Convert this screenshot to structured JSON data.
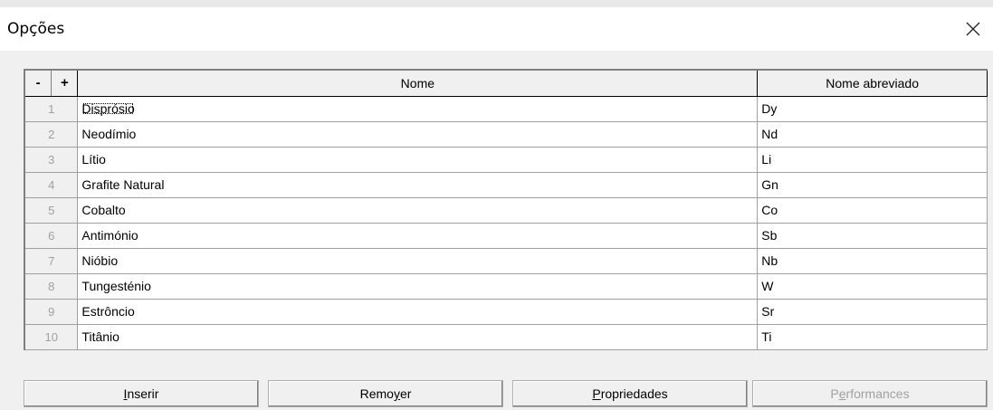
{
  "dialog": {
    "title": "Opções",
    "close_label": "✕"
  },
  "grid": {
    "ctrl_minus": "-",
    "ctrl_plus": "+",
    "columns": [
      "Nome",
      "Nome abreviado"
    ],
    "rows": [
      {
        "num": "1",
        "name": "Disprósio",
        "abbr": "Dy"
      },
      {
        "num": "2",
        "name": "Neodímio",
        "abbr": "Nd"
      },
      {
        "num": "3",
        "name": "Lítio",
        "abbr": "Li"
      },
      {
        "num": "4",
        "name": "Grafite Natural",
        "abbr": "Gn"
      },
      {
        "num": "5",
        "name": "Cobalto",
        "abbr": "Co"
      },
      {
        "num": "6",
        "name": "Antimónio",
        "abbr": "Sb"
      },
      {
        "num": "7",
        "name": "Nióbio",
        "abbr": "Nb"
      },
      {
        "num": "8",
        "name": "Tungesténio",
        "abbr": "W"
      },
      {
        "num": "9",
        "name": "Estrôncio",
        "abbr": "Sr"
      },
      {
        "num": "10",
        "name": "Titânio",
        "abbr": "Ti"
      }
    ]
  },
  "buttons": {
    "insert": {
      "pre": "",
      "key": "I",
      "post": "nserir"
    },
    "remove": {
      "pre": "Remo",
      "key": "y",
      "post": "er"
    },
    "properties": {
      "pre": "",
      "key": "P",
      "post": "ropriedades"
    },
    "performances": {
      "pre": "P",
      "key": "e",
      "post": "rformances"
    }
  }
}
